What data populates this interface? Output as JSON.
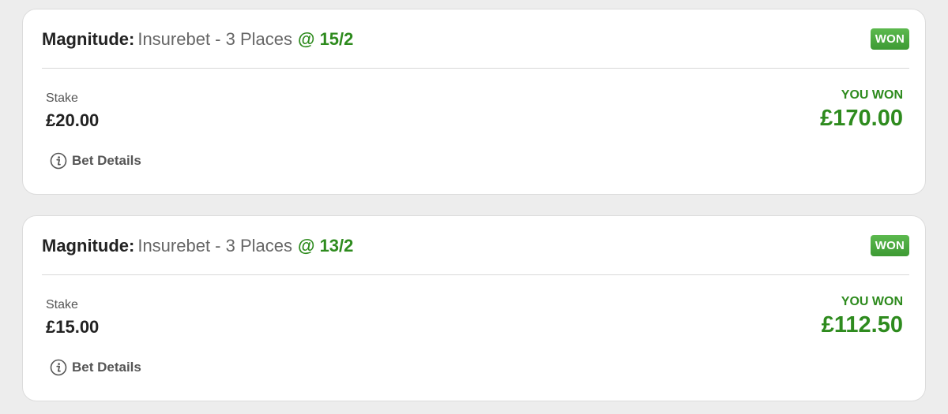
{
  "bets": [
    {
      "selection": "Magnitude:",
      "market": "Insurebet - 3 Places",
      "odds": "@ 15/2",
      "status_badge": "WON",
      "stake_label": "Stake",
      "stake_value": "£20.00",
      "return_label": "YOU WON",
      "return_value": "£170.00",
      "details_label": "Bet Details",
      "details_icon": "info-circle-icon"
    },
    {
      "selection": "Magnitude:",
      "market": "Insurebet - 3 Places",
      "odds": "@ 13/2",
      "status_badge": "WON",
      "stake_label": "Stake",
      "stake_value": "£15.00",
      "return_label": "YOU WON",
      "return_value": "£112.50",
      "details_label": "Bet Details",
      "details_icon": "info-circle-icon"
    }
  ],
  "colors": {
    "background": "#ededed",
    "card": "#ffffff",
    "accent_green": "#2e8b1e",
    "badge_green": "#4caa40",
    "text_dark": "#222222",
    "text_muted": "#666666"
  }
}
